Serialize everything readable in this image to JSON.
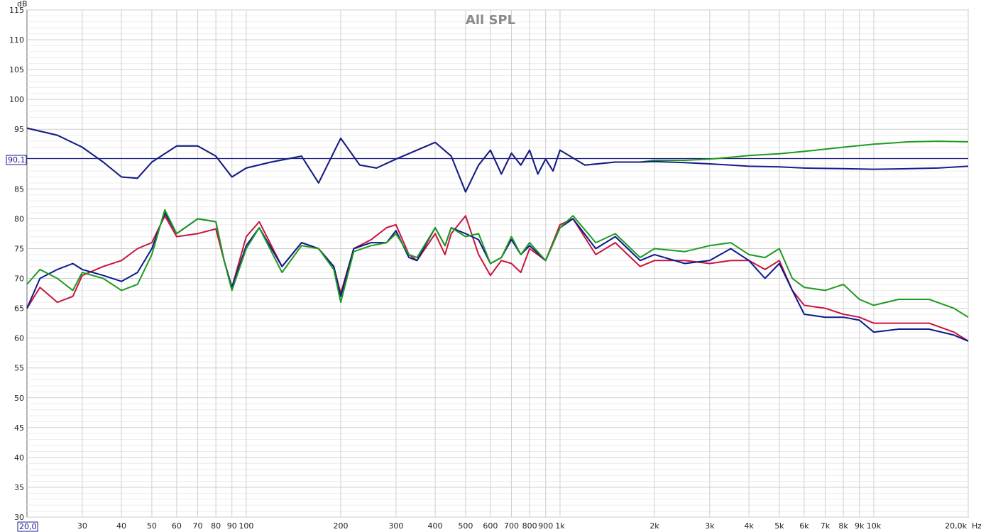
{
  "chart_data": {
    "type": "line",
    "title": "All SPL",
    "ylabel": "dB",
    "xunit": "Hz",
    "xscale": "log",
    "xlim": [
      20,
      20000
    ],
    "ylim": [
      30,
      115
    ],
    "grid": true,
    "y_ticks": [
      "115",
      "110",
      "105",
      "100",
      "95",
      "90",
      "85",
      "80",
      "75",
      "70",
      "65",
      "60",
      "55",
      "50",
      "45",
      "40",
      "35",
      "30"
    ],
    "x_ticks": [
      {
        "f": 30,
        "label": "30"
      },
      {
        "f": 40,
        "label": "40"
      },
      {
        "f": 50,
        "label": "50"
      },
      {
        "f": 60,
        "label": "60"
      },
      {
        "f": 70,
        "label": "70"
      },
      {
        "f": 80,
        "label": "80"
      },
      {
        "f": 90,
        "label": "90"
      },
      {
        "f": 100,
        "label": "100"
      },
      {
        "f": 200,
        "label": "200"
      },
      {
        "f": 300,
        "label": "300"
      },
      {
        "f": 400,
        "label": "400"
      },
      {
        "f": 500,
        "label": "500"
      },
      {
        "f": 600,
        "label": "600"
      },
      {
        "f": 700,
        "label": "700"
      },
      {
        "f": 800,
        "label": "800"
      },
      {
        "f": 900,
        "label": "900"
      },
      {
        "f": 1000,
        "label": "1k"
      },
      {
        "f": 2000,
        "label": "2k"
      },
      {
        "f": 3000,
        "label": "3k"
      },
      {
        "f": 4000,
        "label": "4k"
      },
      {
        "f": 5000,
        "label": "5k"
      },
      {
        "f": 6000,
        "label": "6k"
      },
      {
        "f": 7000,
        "label": "7k"
      },
      {
        "f": 8000,
        "label": "8k"
      },
      {
        "f": 9000,
        "label": "9k"
      },
      {
        "f": 10000,
        "label": "10k"
      },
      {
        "f": 20000,
        "label": "20,0k"
      }
    ],
    "start_label": "20,0",
    "cursor": {
      "value": 90.1,
      "label": "90,1",
      "color": "#1a1a8c"
    },
    "series": [
      {
        "color": "#1f9a1f",
        "x": [
          20,
          25,
          30,
          35,
          40,
          45,
          50,
          60,
          70,
          80,
          90,
          100,
          120,
          150,
          170,
          200,
          230,
          260,
          300,
          350,
          400,
          450,
          500,
          550,
          600,
          650,
          700,
          750,
          800,
          850,
          900,
          950,
          1000,
          1200,
          1500,
          1800,
          2000,
          2500,
          3000,
          3500,
          4000,
          5000,
          6000,
          8000,
          10000,
          13000,
          16000,
          20000
        ],
        "y": [
          95.2,
          94,
          92,
          89.5,
          87,
          86.8,
          89.5,
          92.2,
          92.2,
          90.5,
          87,
          88.5,
          89.5,
          90.5,
          86,
          93.5,
          89,
          88.5,
          90,
          91.5,
          92.8,
          90.5,
          84.5,
          89,
          91.5,
          87.5,
          91,
          89,
          91.5,
          87.5,
          90,
          88,
          91.5,
          89,
          89.5,
          89.5,
          89.8,
          89.8,
          90,
          90.3,
          90.6,
          90.9,
          91.3,
          92,
          92.5,
          92.9,
          93,
          92.9
        ]
      },
      {
        "color": "#1a1a8c",
        "x": [
          20,
          25,
          30,
          35,
          40,
          45,
          50,
          60,
          70,
          80,
          90,
          100,
          120,
          150,
          170,
          200,
          230,
          260,
          300,
          350,
          400,
          450,
          500,
          550,
          600,
          650,
          700,
          750,
          800,
          850,
          900,
          950,
          1000,
          1200,
          1500,
          1800,
          2000,
          2500,
          3000,
          3500,
          4000,
          5000,
          6000,
          8000,
          10000,
          13000,
          16000,
          20000
        ],
        "y": [
          95.2,
          94,
          92,
          89.5,
          87,
          86.8,
          89.5,
          92.2,
          92.2,
          90.5,
          87,
          88.5,
          89.5,
          90.5,
          86,
          93.5,
          89,
          88.5,
          90,
          91.5,
          92.8,
          90.5,
          84.5,
          89,
          91.5,
          87.5,
          91,
          89,
          91.5,
          87.5,
          90,
          88,
          91.5,
          89,
          89.5,
          89.5,
          89.6,
          89.4,
          89.2,
          89,
          88.8,
          88.7,
          88.5,
          88.4,
          88.3,
          88.4,
          88.5,
          88.8
        ]
      },
      {
        "color": "#c8143c",
        "x": [
          20,
          22,
          25,
          28,
          30,
          35,
          40,
          45,
          50,
          55,
          60,
          70,
          80,
          85,
          90,
          100,
          110,
          130,
          150,
          170,
          190,
          200,
          220,
          250,
          280,
          300,
          330,
          350,
          400,
          430,
          450,
          500,
          550,
          600,
          650,
          700,
          750,
          800,
          900,
          1000,
          1100,
          1300,
          1500,
          1800,
          2000,
          2500,
          3000,
          3500,
          4000,
          4500,
          5000,
          5500,
          6000,
          7000,
          8000,
          9000,
          10000,
          12000,
          15000,
          18000,
          20000
        ],
        "y": [
          65,
          68.5,
          66,
          67,
          70.5,
          72,
          73,
          75,
          76,
          80.5,
          77,
          77.5,
          78.3,
          73,
          68.5,
          77,
          79.5,
          72,
          76,
          75,
          72,
          67.5,
          75,
          76.5,
          78.5,
          79,
          74,
          73,
          77.5,
          74,
          77.5,
          80.5,
          74,
          70.5,
          73,
          72.5,
          71,
          75,
          73,
          79,
          80,
          74,
          76,
          72,
          73,
          73,
          72.5,
          73,
          73,
          71.5,
          73,
          68,
          65.5,
          65,
          64,
          63.5,
          62.5,
          62.5,
          62.5,
          61,
          59.5
        ]
      },
      {
        "color": "#0a1a8c",
        "x": [
          20,
          22,
          25,
          28,
          30,
          35,
          40,
          45,
          50,
          55,
          60,
          70,
          80,
          85,
          90,
          100,
          110,
          130,
          150,
          170,
          190,
          200,
          220,
          250,
          280,
          300,
          330,
          350,
          400,
          430,
          450,
          500,
          550,
          600,
          650,
          700,
          750,
          800,
          900,
          1000,
          1100,
          1300,
          1500,
          1800,
          2000,
          2500,
          3000,
          3500,
          4000,
          4500,
          5000,
          5500,
          6000,
          7000,
          8000,
          9000,
          10000,
          12000,
          15000,
          18000,
          20000
        ],
        "y": [
          65,
          70,
          71.5,
          72.5,
          71.5,
          70.5,
          69.5,
          71,
          75,
          81,
          77.5,
          80,
          79.5,
          73,
          68.5,
          75.5,
          78.5,
          72,
          76,
          75,
          72,
          67,
          75,
          76,
          76,
          78,
          73.5,
          73,
          78.5,
          75.5,
          78.5,
          77.5,
          76.5,
          72.5,
          73.5,
          76.5,
          74,
          75.5,
          73,
          78.5,
          80,
          75,
          77,
          73,
          74,
          72.5,
          73,
          75,
          73,
          70,
          72.5,
          68,
          64,
          63.5,
          63.5,
          63,
          61,
          61.5,
          61.5,
          60.5,
          59.5
        ]
      },
      {
        "color": "#1f9a1f",
        "x": [
          20,
          22,
          25,
          28,
          30,
          35,
          40,
          45,
          50,
          55,
          60,
          70,
          80,
          85,
          90,
          100,
          110,
          130,
          150,
          170,
          190,
          200,
          220,
          250,
          280,
          300,
          330,
          350,
          400,
          430,
          450,
          500,
          550,
          600,
          650,
          700,
          750,
          800,
          900,
          1000,
          1100,
          1300,
          1500,
          1800,
          2000,
          2500,
          3000,
          3500,
          4000,
          4500,
          5000,
          5500,
          6000,
          7000,
          8000,
          9000,
          10000,
          12000,
          15000,
          18000,
          20000
        ],
        "y": [
          69,
          71.5,
          70,
          68,
          71,
          70,
          68,
          69,
          74,
          81.5,
          77.5,
          80,
          79.5,
          73,
          68,
          75,
          78.5,
          71,
          75.5,
          75,
          71.5,
          66,
          74.5,
          75.5,
          76,
          77.5,
          74,
          73.5,
          78.5,
          75.5,
          78.5,
          77,
          77.5,
          72.5,
          73.5,
          77,
          74,
          76,
          73,
          78.5,
          80.5,
          76,
          77.5,
          73.5,
          75,
          74.5,
          75.5,
          76,
          74,
          73.5,
          75,
          70,
          68.5,
          68,
          69,
          66.5,
          65.5,
          66.5,
          66.5,
          65,
          63.5
        ]
      }
    ]
  }
}
